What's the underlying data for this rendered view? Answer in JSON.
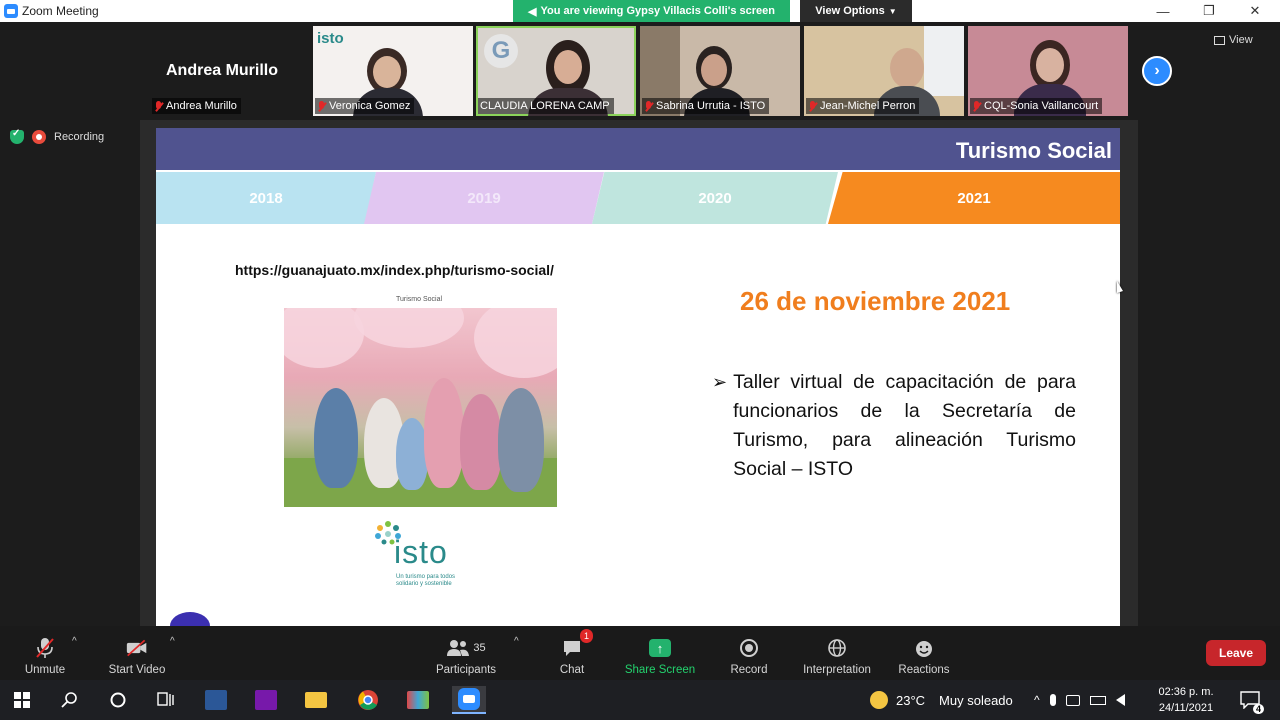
{
  "window": {
    "title": "Zoom Meeting",
    "viewing_banner": "You are viewing Gypsy Villacis Colli's screen",
    "view_options": "View Options",
    "min": "—",
    "restore": "❐",
    "close": "✕"
  },
  "speaker": {
    "big_name": "Andrea Murillo",
    "label": "Andrea Murillo"
  },
  "participants": [
    {
      "name": "Veronica Gomez"
    },
    {
      "name": "CLAUDIA LORENA CAMP"
    },
    {
      "name": "Sabrina Urrutia - ISTO"
    },
    {
      "name": "Jean-Michel Perron"
    },
    {
      "name": "CQL-Sonia Vaillancourt"
    }
  ],
  "tile_logos": {
    "isto": "isto",
    "g": "G"
  },
  "view_button": "View",
  "recording_label": "Recording",
  "slide": {
    "title": "Turismo Social",
    "years": [
      "2018",
      "2019",
      "2020",
      "2021"
    ],
    "url": "https://guanajuato.mx/index.php/turismo-social/",
    "photo_caption": "Turismo Social",
    "logo": "isto",
    "logo_tagline": "Un turismo para todos solidario y sostenible",
    "date": "26 de noviembre 2021",
    "bullet": "Taller virtual de capacitación de para funcionarios de la Secretaría de Turismo, para alineación Turismo Social – ISTO"
  },
  "toolbar": {
    "unmute": "Unmute",
    "start_video": "Start Video",
    "participants": "Participants",
    "participants_count": "35",
    "chat": "Chat",
    "chat_badge": "1",
    "share_screen": "Share Screen",
    "record": "Record",
    "interpretation": "Interpretation",
    "reactions": "Reactions",
    "leave": "Leave"
  },
  "taskbar": {
    "weather_temp": "23°C",
    "weather_desc": "Muy soleado",
    "time": "02:36 p. m.",
    "date": "24/11/2021",
    "notif_count": "4"
  },
  "colors": {
    "zoom_blue": "#2d8cff",
    "share_green": "#23b26d",
    "slide_header": "#50538f",
    "year_2021": "#f68a1f",
    "date_orange": "#f07e1e",
    "leave_red": "#c7262b"
  }
}
